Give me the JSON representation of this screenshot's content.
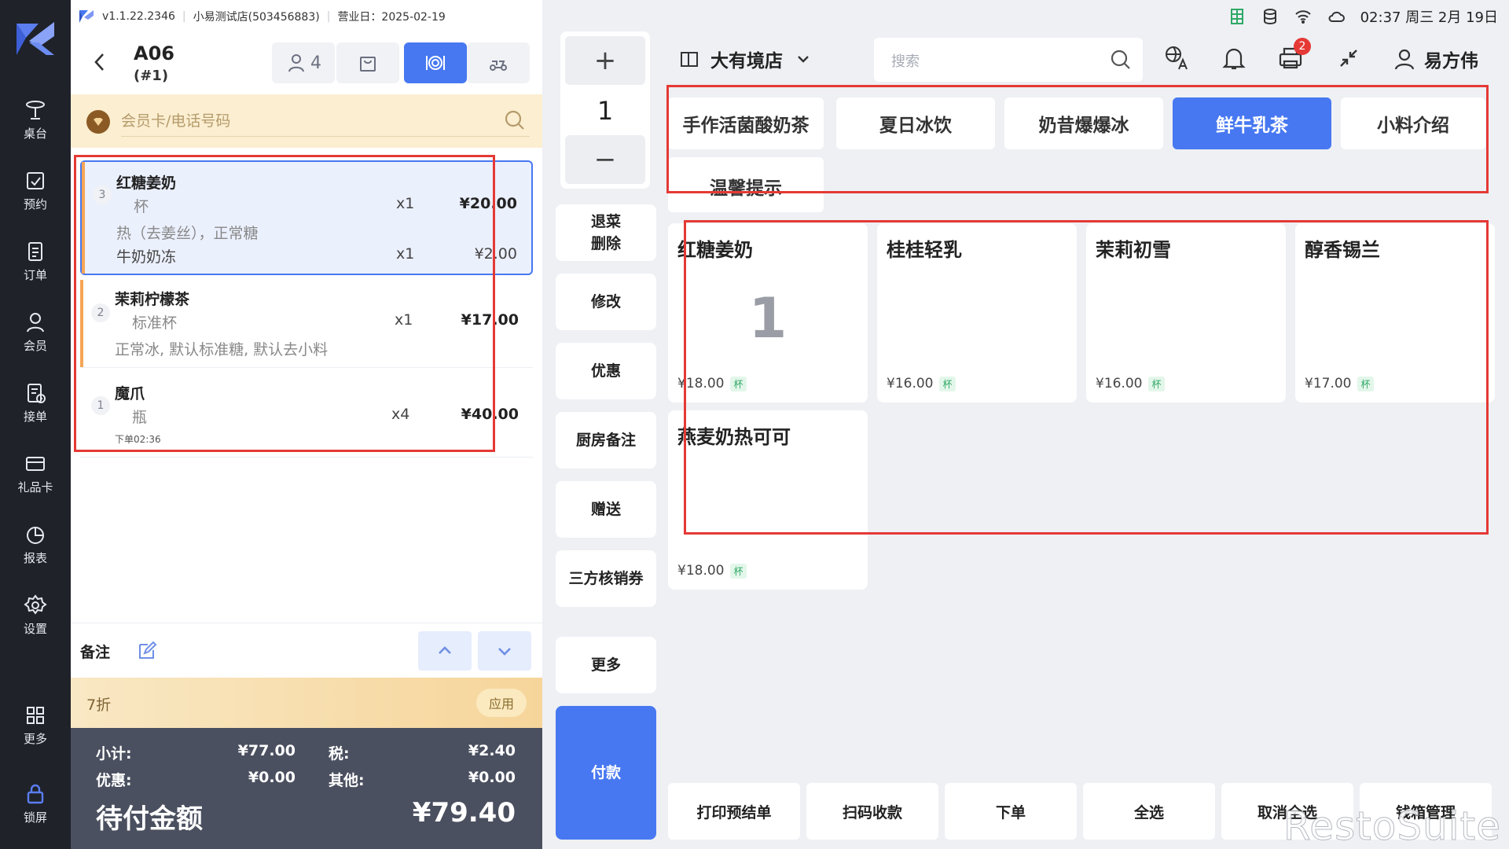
{
  "topbar": {
    "version": "v1.1.22.2346",
    "store_name": "小易测试店(503456883)",
    "business_day": "营业日：2025-02-19"
  },
  "nav": [
    {
      "label": "桌台",
      "icon": "table-icon"
    },
    {
      "label": "预约",
      "icon": "reservation-icon"
    },
    {
      "label": "订单",
      "icon": "order-icon"
    },
    {
      "label": "会员",
      "icon": "member-icon"
    },
    {
      "label": "接单",
      "icon": "accept-order-icon"
    },
    {
      "label": "礼品卡",
      "icon": "gift-card-icon"
    },
    {
      "label": "报表",
      "icon": "report-icon"
    },
    {
      "label": "设置",
      "icon": "settings-icon"
    },
    {
      "label": "更多",
      "icon": "more-grid-icon"
    },
    {
      "label": "锁屏",
      "icon": "lock-icon"
    }
  ],
  "order": {
    "table": "A06",
    "order_no": "(#1)",
    "guests": "4",
    "member_placeholder": "会员卡/电话号码",
    "items": [
      {
        "index": "3",
        "name": "红糖姜奶",
        "spec": "杯",
        "qty": "x1",
        "price": "¥20.00",
        "note": "热（去姜丝），正常糖",
        "addon": "牛奶奶冻",
        "addon_qty": "x1",
        "addon_price": "¥2.00"
      },
      {
        "index": "2",
        "name": "茉莉柠檬茶",
        "spec": "标准杯",
        "qty": "x1",
        "price": "¥17.00",
        "note": "正常冰, 默认标准糖, 默认去小料"
      },
      {
        "index": "1",
        "name": "魔爪",
        "spec": "瓶",
        "qty": "x4",
        "price": "¥40.00",
        "time": "下单02:36"
      }
    ],
    "remark_label": "备注",
    "discount_label": "7折",
    "apply_label": "应用",
    "summary": {
      "subtotal_label": "小计:",
      "subtotal": "¥77.00",
      "tax_label": "税:",
      "tax": "¥2.40",
      "discount_label": "优惠:",
      "discount": "¥0.00",
      "other_label": "其他:",
      "other": "¥0.00",
      "due_label": "待付金额",
      "due": "¥79.40"
    }
  },
  "actions": {
    "plus": "+",
    "qty": "1",
    "minus": "−",
    "buttons": [
      "退菜\n删除",
      "修改",
      "优惠",
      "厨房备注",
      "赠送",
      "三方核销券",
      "更多"
    ],
    "pay": "付款"
  },
  "menu": {
    "store": "大有境店",
    "search_placeholder": "搜索",
    "status_time": "02:37 周三 2月 19日",
    "notification_count": "2",
    "user": "易方伟",
    "categories": [
      "手作活菌酸奶茶",
      "夏日冰饮",
      "奶昔爆爆冰",
      "鲜牛乳茶",
      "小料介绍",
      "温馨提示"
    ],
    "active_category": "鲜牛乳茶",
    "dishes": [
      {
        "name": "红糖姜奶",
        "count": "1",
        "price": "¥18.00",
        "unit": "杯"
      },
      {
        "name": "桂桂轻乳",
        "count": "",
        "price": "¥16.00",
        "unit": "杯"
      },
      {
        "name": "茉莉初雪",
        "count": "",
        "price": "¥16.00",
        "unit": "杯"
      },
      {
        "name": "醇香锡兰",
        "count": "",
        "price": "¥17.00",
        "unit": "杯"
      },
      {
        "name": "燕麦奶热可可",
        "count": "",
        "price": "¥18.00",
        "unit": "杯"
      }
    ],
    "footer": [
      "打印预结单",
      "扫码收款",
      "下单",
      "全选",
      "取消全选",
      "钱箱管理"
    ]
  },
  "watermark": "RestoSuite",
  "colors": {
    "accent": "#4778f1",
    "nav_bg": "#1f2229",
    "highlight": "#e53935",
    "discount_bg": "#f6d59a"
  }
}
